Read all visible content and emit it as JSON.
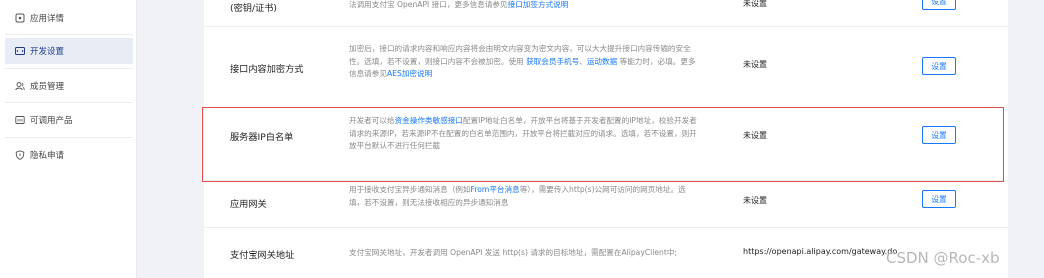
{
  "sidebar": {
    "items": [
      {
        "label": "应用详情",
        "icon": "app-icon"
      },
      {
        "label": "开发设置",
        "icon": "code-icon"
      },
      {
        "label": "成员管理",
        "icon": "members-icon"
      },
      {
        "label": "可调用产品",
        "icon": "products-icon"
      },
      {
        "label": "隐私申请",
        "icon": "shield-icon"
      }
    ],
    "active_index": 1,
    "active_color": "#1f3b8a"
  },
  "rows": [
    {
      "title": "(密钥/证书)",
      "desc": [
        "法调用支付宝 OpenAPI 接口，更多信息请参见",
        "接口加签方式说明"
      ],
      "status": "未设置",
      "button": "设置"
    },
    {
      "title": "接口内容加密方式",
      "desc_lines": [
        [
          "加密后，接口的请求内容和响应内容将会由明文内容变为密文内容，可以大大提升接口内容传输的安全"
        ],
        [
          "性。选填，若不设置，则接口内容不会被加密。使用 ",
          "获取会员手机号",
          "、",
          "运动数据",
          " 等能力时，必填。更多"
        ],
        [
          "信息请参见",
          "AES加密说明"
        ]
      ],
      "status": "未设置",
      "button": "设置"
    },
    {
      "title": "服务器IP白名单",
      "desc_lines": [
        [
          "开发者可以给",
          "资金操作类敏感接口",
          "配置IP地址白名单，开放平台将基于开发者配置的IP地址，校验开发者"
        ],
        [
          "请求的来源IP，若来源IP不在配置的白名单范围内，开放平台将拦截对应的请求。选填，若不设置，则开"
        ],
        [
          "放平台默认不进行任何拦截"
        ]
      ],
      "status": "未设置",
      "button": "设置"
    },
    {
      "title": "应用网关",
      "desc_lines": [
        [
          "用于接收支付宝异步通知消息（例如",
          "From平台消息",
          "等），需要传入http(s)公网可访问的网页地址。选"
        ],
        [
          "填，若不设置，则无法接收相应的异步通知消息"
        ]
      ],
      "status": "未设置",
      "button": "设置"
    },
    {
      "title": "支付宝网关地址",
      "desc_lines": [
        [
          "支付宝网关地址，开发者调用 OpenAPI 发送 http(s) 请求的目标地址，需配置在AlipayClient中;"
        ]
      ],
      "status": "https://openapi.alipay.com/gateway.do"
    }
  ],
  "watermark": "CSDN @Roc-xb",
  "colors": {
    "link": "#1677ff",
    "highlight": "#e05050"
  }
}
